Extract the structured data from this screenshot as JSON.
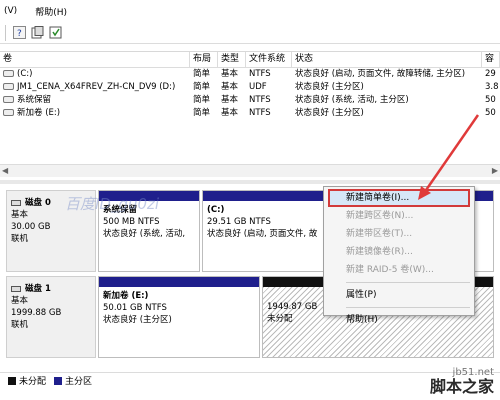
{
  "menubar": {
    "items": [
      "(V)",
      "帮助(H)"
    ]
  },
  "volumes": {
    "headers": [
      "卷",
      "布局",
      "类型",
      "文件系统",
      "状态",
      "容"
    ],
    "rows": [
      {
        "name": "(C:)",
        "layout": "简单",
        "type": "基本",
        "fs": "NTFS",
        "status": "状态良好 (启动, 页面文件, 故障转储, 主分区)",
        "cap": "29"
      },
      {
        "name": "JM1_CENA_X64FREV_ZH-CN_DV9 (D:)",
        "layout": "简单",
        "type": "基本",
        "fs": "UDF",
        "status": "状态良好 (主分区)",
        "cap": "3.8"
      },
      {
        "name": "系统保留",
        "layout": "简单",
        "type": "基本",
        "fs": "NTFS",
        "status": "状态良好 (系统, 活动, 主分区)",
        "cap": "50"
      },
      {
        "name": "新加卷 (E:)",
        "layout": "简单",
        "type": "基本",
        "fs": "NTFS",
        "status": "状态良好 (主分区)",
        "cap": "50"
      }
    ]
  },
  "disks": [
    {
      "name": "磁盘 0",
      "type": "基本",
      "size": "30.00 GB",
      "state": "联机",
      "partitions": [
        {
          "name": "系统保留",
          "detail": "500 MB NTFS",
          "status": "状态良好 (系统, 活动,"
        },
        {
          "name": "(C:)",
          "detail": "29.51 GB NTFS",
          "status": "状态良好 (启动, 页面文件, 故"
        }
      ]
    },
    {
      "name": "磁盘 1",
      "type": "基本",
      "size": "1999.88 GB",
      "state": "联机",
      "partitions": [
        {
          "name": "新加卷 (E:)",
          "detail": "50.01 GB NTFS",
          "status": "状态良好 (主分区)"
        },
        {
          "name": "",
          "detail": "1949.87 GB",
          "status": "未分配"
        }
      ]
    }
  ],
  "watermark": "百度ID_gu0zi",
  "context_menu": {
    "items": [
      {
        "label": "新建简单卷(I)...",
        "state": "highlighted"
      },
      {
        "label": "新建跨区卷(N)...",
        "state": "disabled"
      },
      {
        "label": "新建带区卷(T)...",
        "state": "disabled"
      },
      {
        "label": "新建镜像卷(R)...",
        "state": "disabled"
      },
      {
        "label": "新建 RAID-5 卷(W)...",
        "state": "disabled"
      },
      {
        "label": "属性(P)",
        "state": "normal"
      },
      {
        "label": "帮助(H)",
        "state": "normal"
      }
    ]
  },
  "legend": {
    "items": [
      {
        "label": "未分配",
        "color": "#111111"
      },
      {
        "label": "主分区",
        "color": "#1f1f8c"
      }
    ]
  },
  "brand": {
    "site": "jb51.net",
    "name": "脚本之家"
  },
  "colors": {
    "primary_partition": "#1f1f8c",
    "unallocated": "#111111",
    "highlight_border": "#d23a3a"
  }
}
